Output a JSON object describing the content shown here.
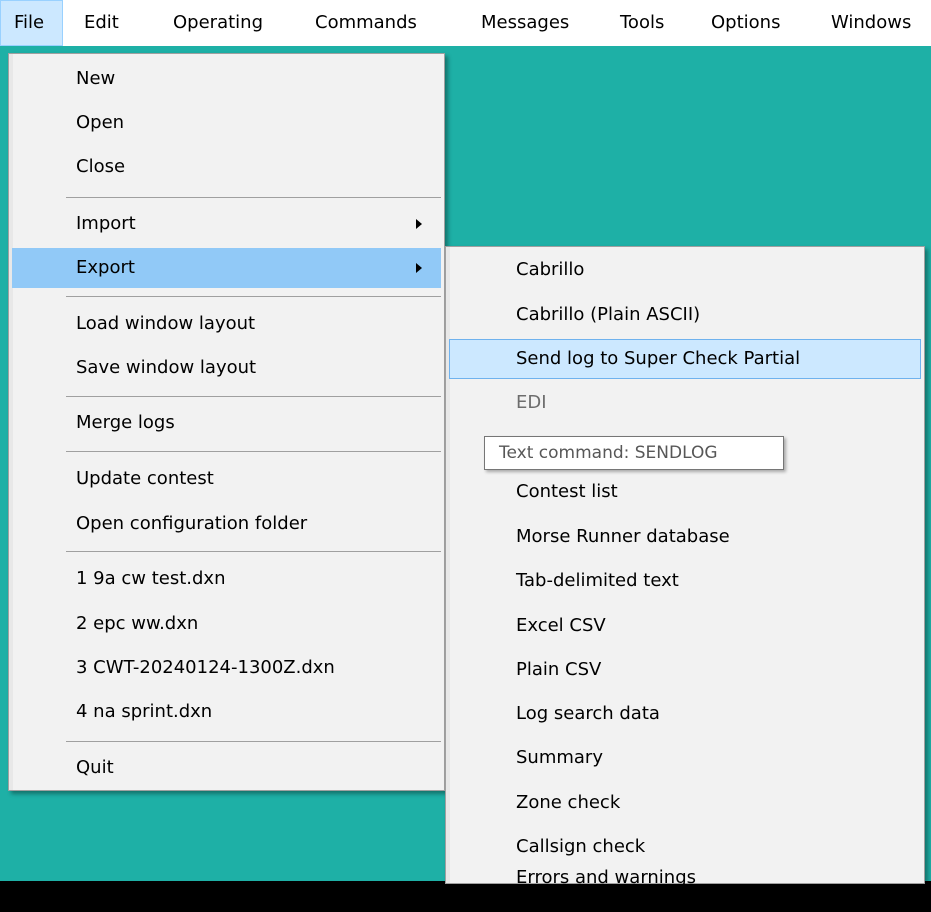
{
  "menubar": {
    "items": [
      "File",
      "Edit",
      "Operating",
      "Commands",
      "Messages",
      "Tools",
      "Options",
      "Windows"
    ]
  },
  "file_menu": {
    "items": {
      "new": "New",
      "open": "Open",
      "close": "Close",
      "import": "Import",
      "export": "Export",
      "load_layout": "Load window layout",
      "save_layout": "Save window layout",
      "merge_logs": "Merge logs",
      "update_contest": "Update contest",
      "open_config": "Open configuration folder",
      "recent1": "1 9a cw test.dxn",
      "recent2": "2 epc ww.dxn",
      "recent3": "3 CWT-20240124-1300Z.dxn",
      "recent4": "4 na sprint.dxn",
      "quit": "Quit"
    }
  },
  "export_menu": {
    "items": {
      "cabrillo": "Cabrillo",
      "cabrillo_ascii": "Cabrillo (Plain ASCII)",
      "send_scp": "Send log to Super Check Partial",
      "edi": "EDI",
      "contest_list": "Contest list",
      "morse_runner": "Morse Runner database",
      "tab_delimited": "Tab-delimited text",
      "excel_csv": "Excel CSV",
      "plain_csv": "Plain CSV",
      "log_search": "Log search data",
      "summary": "Summary",
      "zone_check": "Zone check",
      "callsign_check": "Callsign check",
      "errors_warnings": "Errors and warnings"
    }
  },
  "tooltip": {
    "text": "Text command: SENDLOG"
  },
  "colors": {
    "workspace": "#1eb0a6",
    "menu_bg": "#f2f2f2",
    "highlight": "#91c9f7",
    "hover": "#cce8ff"
  }
}
